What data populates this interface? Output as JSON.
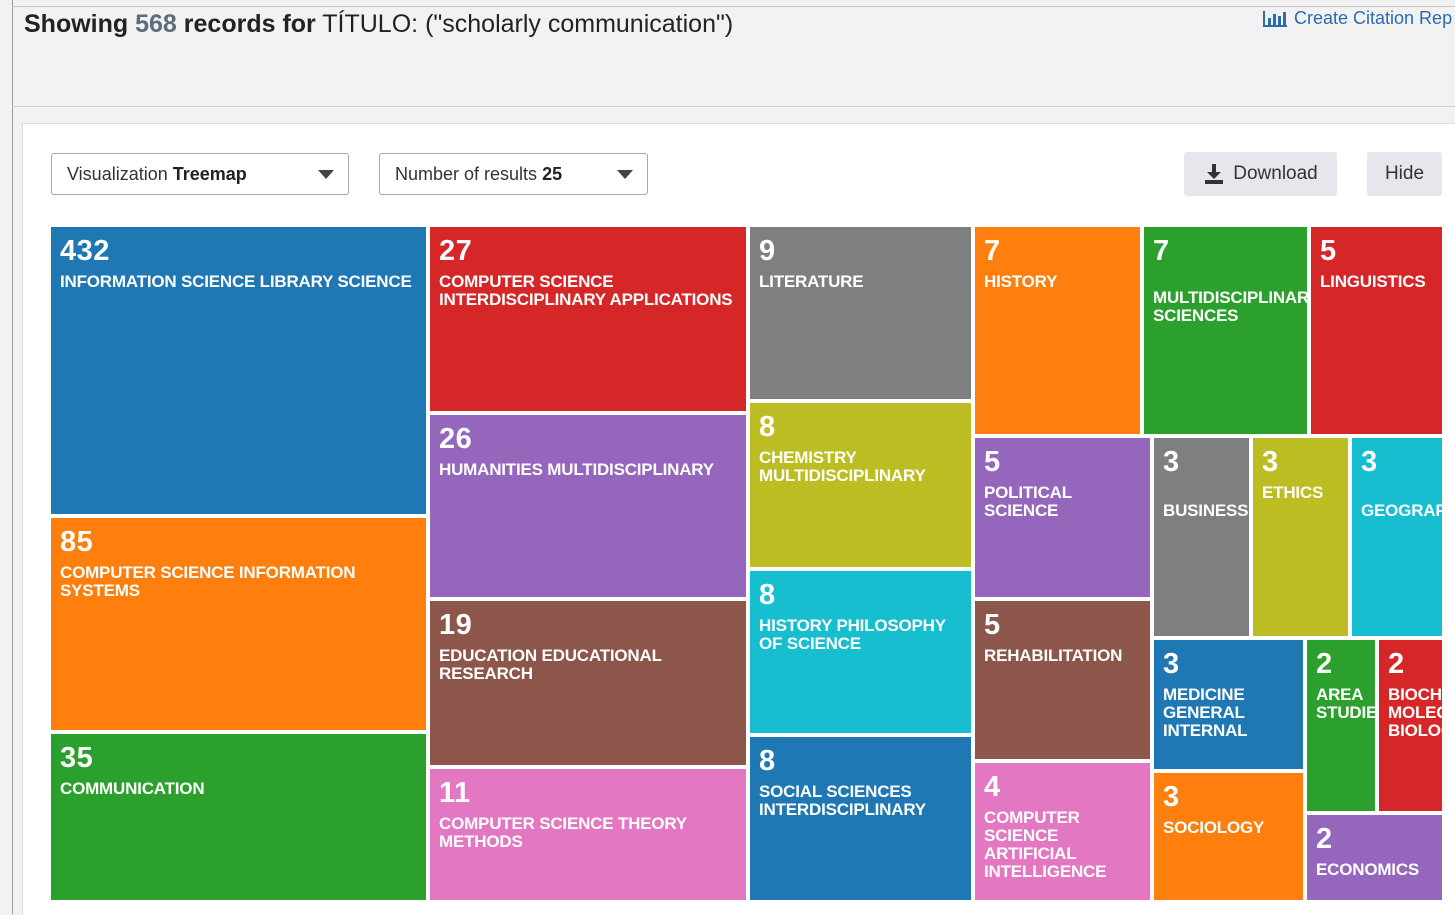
{
  "header": {
    "showing_prefix": "Showing",
    "record_count": "568",
    "records_for": "records for",
    "field": "TÍTULO:",
    "query": "(\"scholarly communication\")",
    "citation_link": "Create Citation Rep"
  },
  "controls": {
    "visualization_label": "Visualization",
    "visualization_value": "Treemap",
    "results_label": "Number of results",
    "results_value": "25",
    "download_label": "Download",
    "hide_label": "Hide"
  },
  "colors": {
    "blue": "#1f77b4",
    "red": "#d62728",
    "gray": "#7f7f7f",
    "orange": "#ff7f0e",
    "green": "#2ca02c",
    "purple": "#9467bd",
    "brown": "#8c564b",
    "pink": "#e377c2",
    "olive": "#bcbd22",
    "cyan": "#17becf"
  },
  "treemap": [
    {
      "value": "432",
      "label": "INFORMATION SCIENCE LIBRARY SCIENCE",
      "color": "#1f77b4"
    },
    {
      "value": "85",
      "label": "COMPUTER SCIENCE INFORMATION\nSYSTEMS",
      "color": "#ff7f0e"
    },
    {
      "value": "35",
      "label": "COMMUNICATION",
      "color": "#2ca02c"
    },
    {
      "value": "27",
      "label": "COMPUTER SCIENCE\nINTERDISCIPLINARY APPLICATIONS",
      "color": "#d62728"
    },
    {
      "value": "26",
      "label": "HUMANITIES MULTIDISCIPLINARY",
      "color": "#9467bd"
    },
    {
      "value": "19",
      "label": "EDUCATION EDUCATIONAL\nRESEARCH",
      "color": "#8c564b"
    },
    {
      "value": "11",
      "label": "COMPUTER SCIENCE THEORY\nMETHODS",
      "color": "#e377c2"
    },
    {
      "value": "9",
      "label": "LITERATURE",
      "color": "#7f7f7f"
    },
    {
      "value": "8",
      "label": "CHEMISTRY\nMULTIDISCIPLINARY",
      "color": "#bcbd22"
    },
    {
      "value": "8",
      "label": "HISTORY PHILOSOPHY\nOF SCIENCE",
      "color": "#17becf"
    },
    {
      "value": "8",
      "label": "SOCIAL SCIENCES\nINTERDISCIPLINARY",
      "color": "#1f77b4"
    },
    {
      "value": "7",
      "label": "HISTORY",
      "color": "#ff7f0e"
    },
    {
      "value": "7",
      "label": "MULTIDISCIPLINARY\nSCIENCES",
      "color": "#2ca02c"
    },
    {
      "value": "5",
      "label": "LINGUISTICS",
      "color": "#d62728"
    },
    {
      "value": "5",
      "label": "POLITICAL\nSCIENCE",
      "color": "#9467bd"
    },
    {
      "value": "5",
      "label": "REHABILITATION",
      "color": "#8c564b"
    },
    {
      "value": "4",
      "label": "COMPUTER\nSCIENCE\nARTIFICIAL\nINTELLIGENCE",
      "color": "#e377c2"
    },
    {
      "value": "3",
      "label": "BUSINESS",
      "color": "#7f7f7f"
    },
    {
      "value": "3",
      "label": "ETHICS",
      "color": "#bcbd22"
    },
    {
      "value": "3",
      "label": "GEOGRAPHY",
      "color": "#17becf"
    },
    {
      "value": "3",
      "label": "MEDICINE\nGENERAL\nINTERNAL",
      "color": "#1f77b4"
    },
    {
      "value": "3",
      "label": "SOCIOLOGY",
      "color": "#ff7f0e"
    },
    {
      "value": "2",
      "label": "AREA\nSTUDIES",
      "color": "#2ca02c"
    },
    {
      "value": "2",
      "label": "BIOCHEMISTRY\nMOLECULAR\nBIOLOGY",
      "color": "#d62728"
    },
    {
      "value": "2",
      "label": "ECONOMICS",
      "color": "#9467bd"
    }
  ]
}
